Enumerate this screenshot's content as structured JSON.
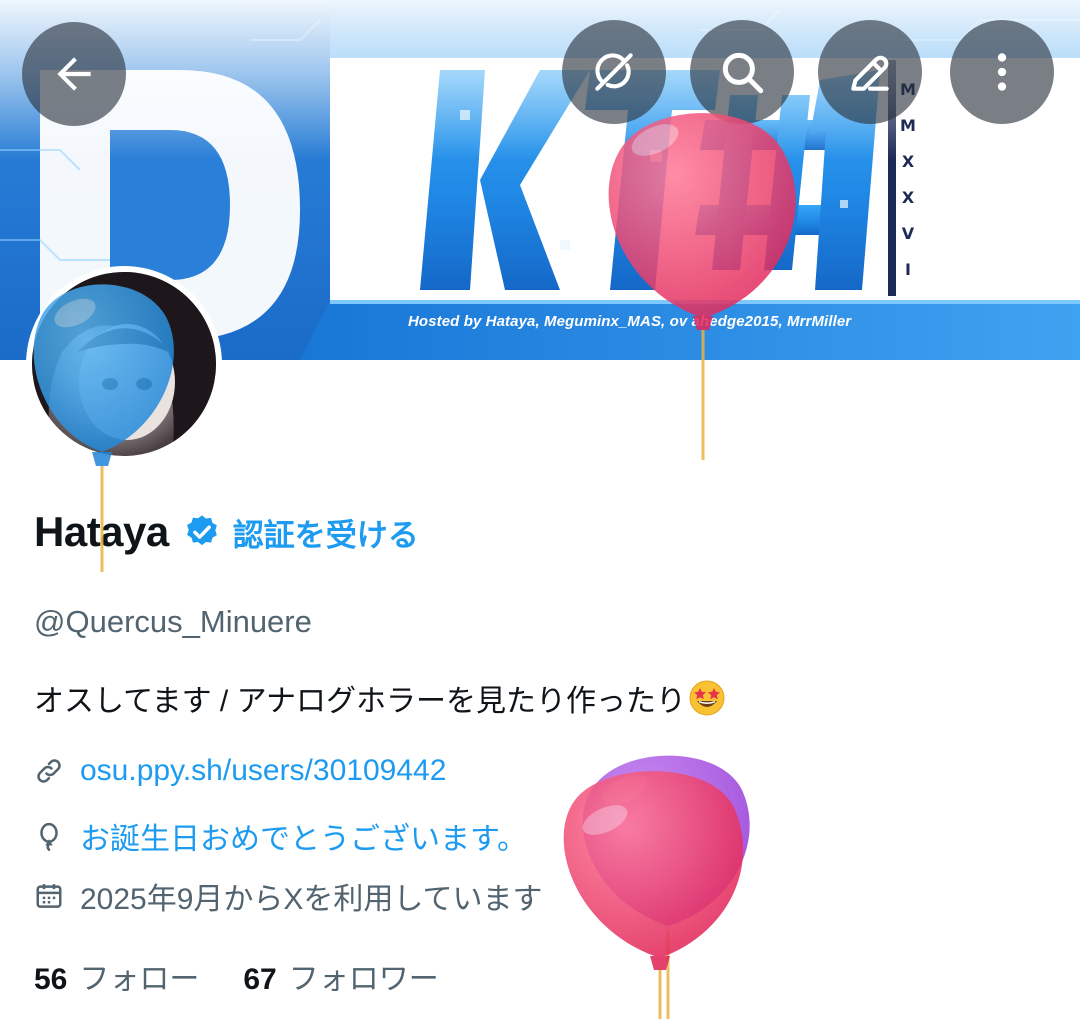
{
  "banner": {
    "title_art": "KTT#1",
    "vertical_text": "MMXXVI",
    "credit": "Hosted by Hataya, Meguminx_MAS, ov   ahedge2015, MrrMiller"
  },
  "top_actions": {
    "back": "back-arrow-icon",
    "grok": "grok-icon",
    "search": "search-icon",
    "edit": "edit-pencil-icon",
    "more": "more-vertical-icon"
  },
  "profile": {
    "display_name": "Hataya",
    "get_verified": "認証を受ける",
    "handle": "@Quercus_Minuere",
    "bio": "オスしてます / アナログホラーを見たり作ったり",
    "bio_emoji": "star-struck-emoji",
    "website": "osu.ppy.sh/users/30109442",
    "birthday": "お誕生日おめでとうございます。",
    "joined": "2025年9月からXを利用しています"
  },
  "stats": {
    "following_count": "56",
    "following_label": "フォロー",
    "followers_count": "67",
    "followers_label": "フォロワー"
  },
  "colors": {
    "accent": "#1d9bf0",
    "secondary_text": "#536471",
    "primary_text": "#0f1419",
    "balloon_red": "#ec3f6e",
    "balloon_blue": "#2c9ae8",
    "balloon_purple": "#a84ee0"
  }
}
